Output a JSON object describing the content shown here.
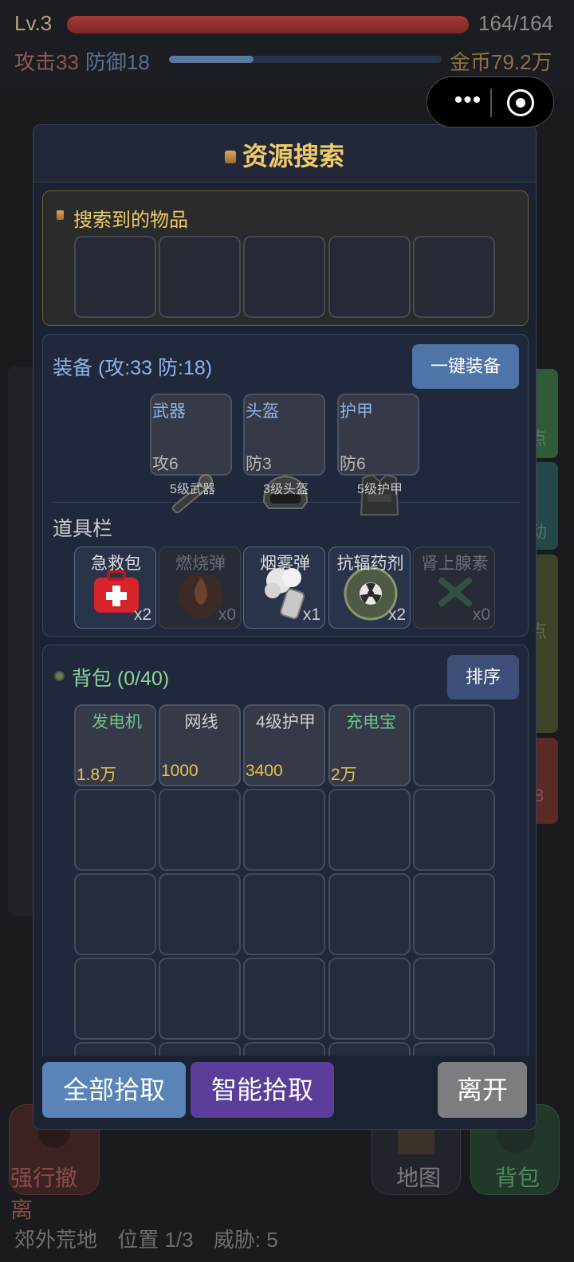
{
  "hud": {
    "level": "Lv.3",
    "hp_text": "164/164",
    "hp_fraction": 1.0,
    "attack": "攻击33",
    "defense": "防御18",
    "xp_fraction": 0.31,
    "gold": "金币79.2万"
  },
  "capsule": {
    "more_icon": "more-dots-icon",
    "close_icon": "target-circle-icon"
  },
  "background": {
    "evacuate_label": "强行撤离",
    "map_label": "地图",
    "bag_label": "背包",
    "side_partials": [
      "点",
      "动",
      "点",
      "8"
    ],
    "status": {
      "location": "郊外荒地",
      "position": "位置 1/3",
      "threat": "威胁: 5"
    }
  },
  "modal": {
    "title": "资源搜索",
    "found": {
      "title": "搜索到的物品",
      "slots": 5
    },
    "equipment": {
      "title": "装备 (攻:33 防:18)",
      "auto_equip_label": "一键装备",
      "slots": [
        {
          "name": "武器",
          "stat": "攻6",
          "level": "5级武器",
          "icon": "wrench-icon"
        },
        {
          "name": "头盔",
          "stat": "防3",
          "level": "3级头盔",
          "icon": "helmet-icon"
        },
        {
          "name": "护甲",
          "stat": "防6",
          "level": "5级护甲",
          "icon": "vest-icon"
        }
      ]
    },
    "tools": {
      "title": "道具栏",
      "items": [
        {
          "name": "急救包",
          "count": "x2",
          "enabled": true,
          "icon": "first-aid-icon"
        },
        {
          "name": "燃烧弹",
          "count": "x0",
          "enabled": false,
          "icon": "fire-bomb-icon"
        },
        {
          "name": "烟雾弹",
          "count": "x1",
          "enabled": true,
          "icon": "smoke-grenade-icon"
        },
        {
          "name": "抗辐药剂",
          "count": "x2",
          "enabled": true,
          "icon": "radiation-pill-icon"
        },
        {
          "name": "肾上腺素",
          "count": "x0",
          "enabled": false,
          "icon": "syringe-icon"
        }
      ]
    },
    "bag": {
      "title": "背包 (0/40)",
      "sort_label": "排序",
      "items": [
        {
          "name": "发电机",
          "price": "1.8万",
          "green": true
        },
        {
          "name": "网线",
          "price": "1000",
          "green": false
        },
        {
          "name": "4级护甲",
          "price": "3400",
          "green": false
        },
        {
          "name": "充电宝",
          "price": "2万",
          "green": true
        }
      ]
    },
    "footer": {
      "pick_all": "全部拾取",
      "smart_pick": "智能拾取",
      "leave": "离开"
    }
  }
}
